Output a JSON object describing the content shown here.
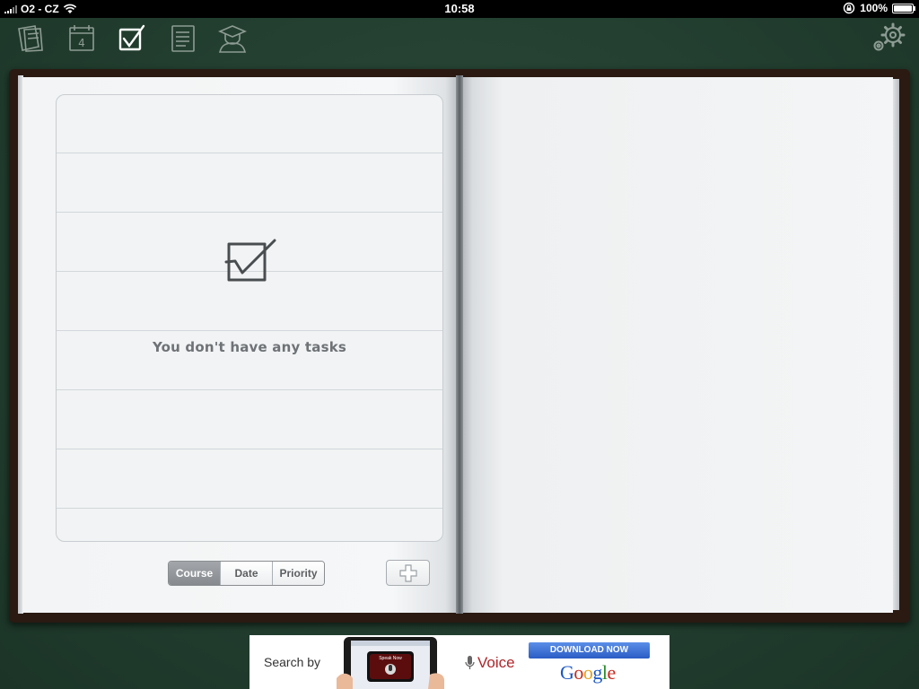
{
  "status_bar": {
    "carrier": "O2 - CZ",
    "time": "10:58",
    "battery": "100%",
    "battery_level": 1.0
  },
  "toolbar": {
    "items": [
      {
        "name": "notebooks",
        "icon": "notebooks-icon",
        "selected": false
      },
      {
        "name": "calendar",
        "icon": "calendar-icon",
        "day": "4",
        "selected": false
      },
      {
        "name": "tasks",
        "icon": "checkbox-icon",
        "selected": true
      },
      {
        "name": "notes",
        "icon": "document-icon",
        "selected": false
      },
      {
        "name": "teachers",
        "icon": "graduate-icon",
        "selected": false
      }
    ],
    "settings_icon": "gears-icon"
  },
  "tasks": {
    "empty_message": "You don't have any tasks",
    "sort_options": [
      "Course",
      "Date",
      "Priority"
    ],
    "selected_sort": "Course"
  },
  "ad": {
    "search_text": "Search by",
    "voice_text": "Voice",
    "download_text": "DOWNLOAD NOW",
    "brand_letters": [
      "G",
      "o",
      "o",
      "g",
      "l",
      "e"
    ],
    "brand_colors": [
      "#1a57c5",
      "#c5281c",
      "#e6a21a",
      "#1a57c5",
      "#2b8d2e",
      "#c5281c"
    ],
    "phone_screen_text": "Speak Now"
  },
  "colors": {
    "chalkboard": "#233f30",
    "page": "#f3f5f6",
    "cover": "#2a1a12"
  }
}
